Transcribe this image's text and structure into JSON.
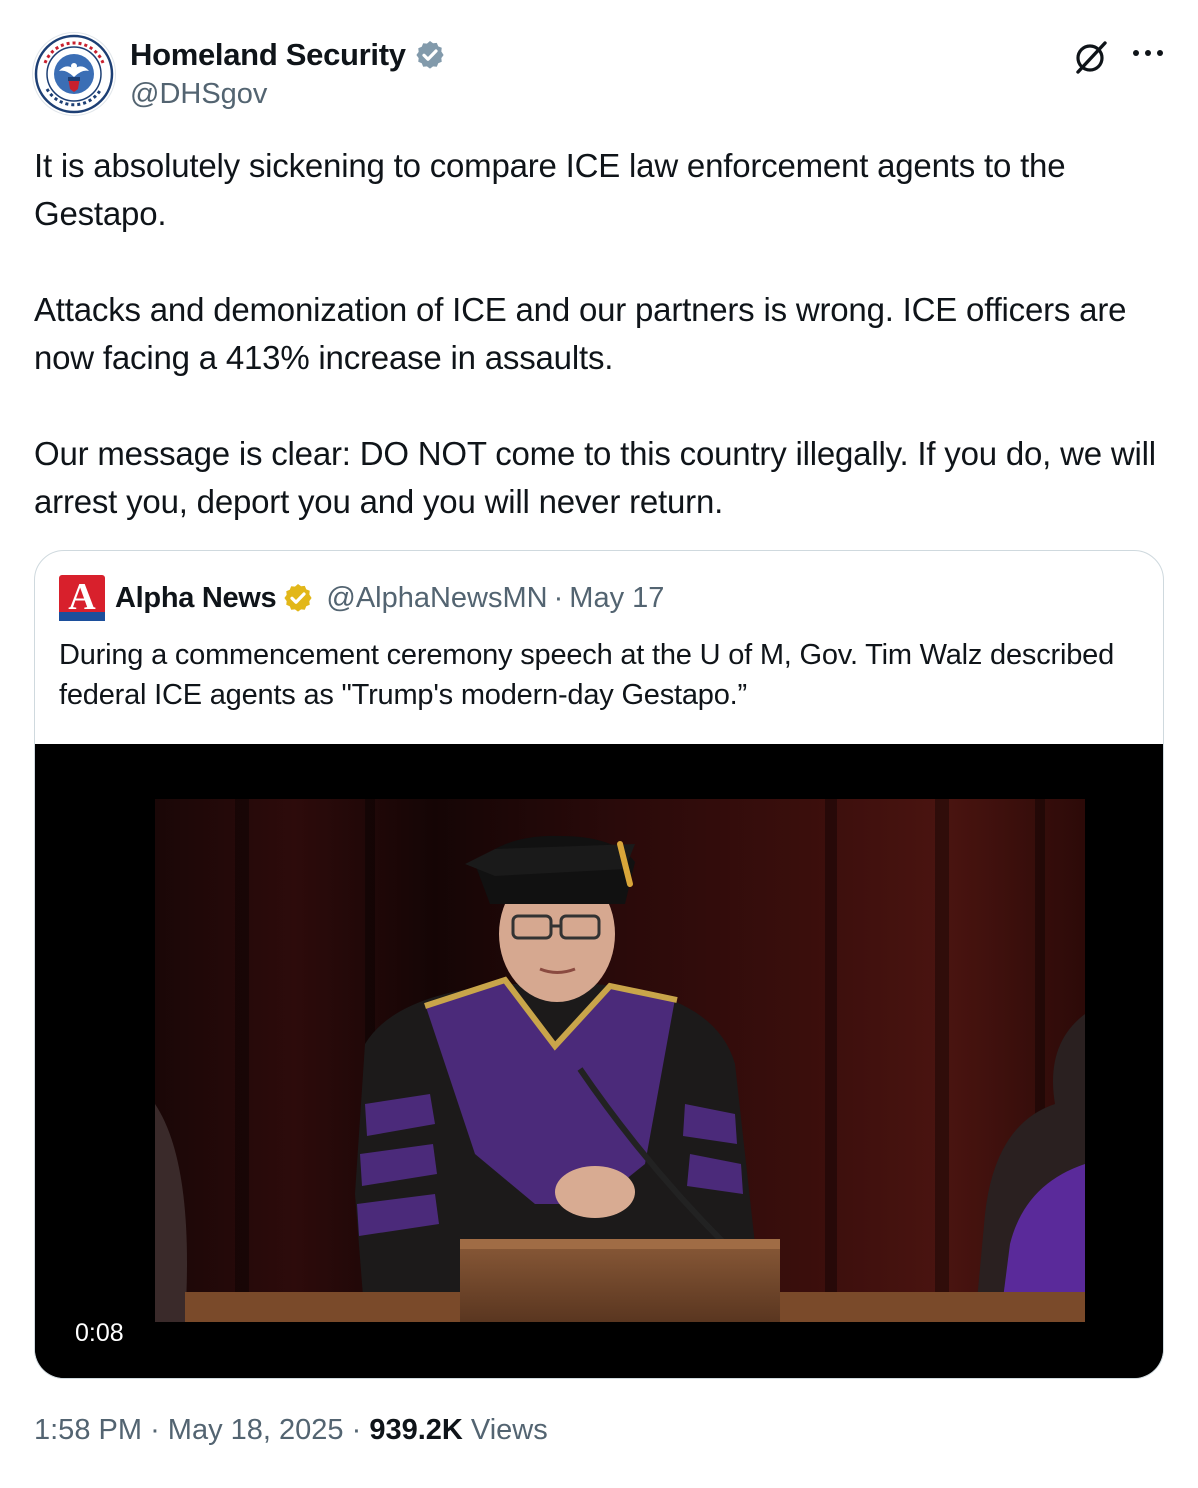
{
  "author": {
    "display_name": "Homeland Security",
    "handle": "@DHSgov",
    "avatar_icon": "dhs-seal-icon",
    "verified_color": "#829aab"
  },
  "actions": {
    "grok_icon": "grok-icon",
    "more_icon": "more-options-icon"
  },
  "tweet": {
    "paragraphs": [
      "It is absolutely sickening to compare ICE law enforcement agents to the Gestapo.",
      "Attacks and demonization of ICE and our partners is wrong. ICE officers are now facing a 413% increase in assaults.",
      "Our message is clear: DO NOT come to this country illegally. If you do, we will arrest you, deport you and you will never return."
    ]
  },
  "quote": {
    "display_name": "Alpha News",
    "handle": "@AlphaNewsMN",
    "separator": "·",
    "date": "May 17",
    "logo_letter": "A",
    "verified_color": "#e2b719",
    "text": "During a commencement ceremony speech at the U of M, Gov. Tim Walz described federal ICE agents as \"Trump's modern-day Gestapo.”",
    "video": {
      "timestamp": "0:08"
    }
  },
  "meta": {
    "time": "1:58 PM",
    "separator": "·",
    "date": "May 18, 2025",
    "views_count": "939.2K",
    "views_label": "Views"
  },
  "colors": {
    "text": "#0f1419",
    "secondary": "#536471",
    "border": "#cfd9de",
    "alpha_news_red": "#d8202c"
  }
}
